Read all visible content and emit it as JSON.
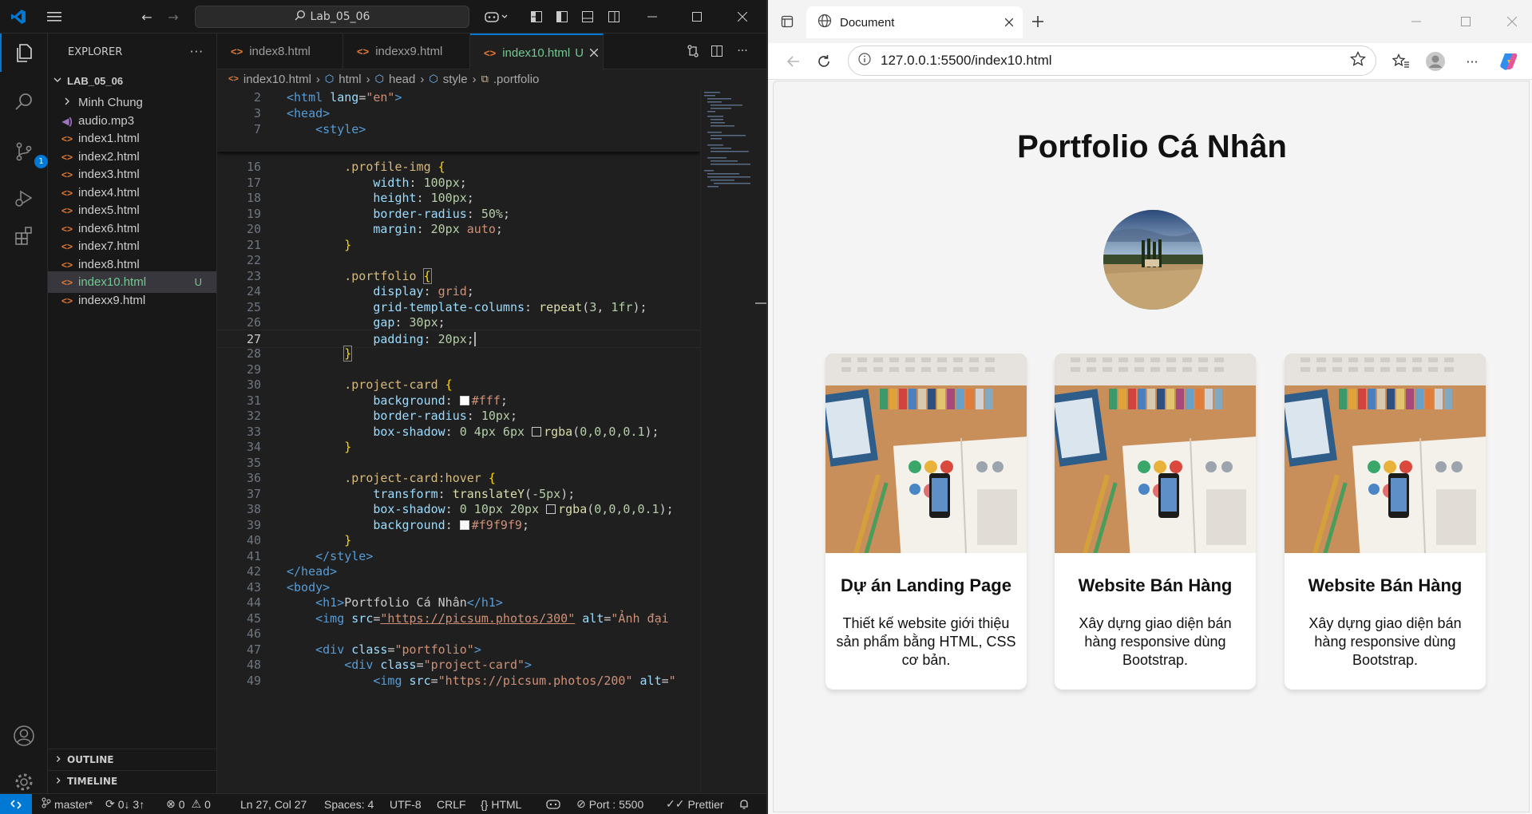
{
  "vscode": {
    "search_text": "Lab_05_06",
    "explorer_title": "EXPLORER",
    "project_name": "LAB_05_06",
    "files": [
      {
        "name": "Minh Chung",
        "type": "folder",
        "status": ""
      },
      {
        "name": "audio.mp3",
        "type": "audio",
        "status": ""
      },
      {
        "name": "index1.html",
        "type": "html",
        "status": ""
      },
      {
        "name": "index2.html",
        "type": "html",
        "status": ""
      },
      {
        "name": "index3.html",
        "type": "html",
        "status": ""
      },
      {
        "name": "index4.html",
        "type": "html",
        "status": ""
      },
      {
        "name": "index5.html",
        "type": "html",
        "status": ""
      },
      {
        "name": "index6.html",
        "type": "html",
        "status": ""
      },
      {
        "name": "index7.html",
        "type": "html",
        "status": ""
      },
      {
        "name": "index8.html",
        "type": "html",
        "status": ""
      },
      {
        "name": "index10.html",
        "type": "html",
        "status": "U"
      },
      {
        "name": "indexx9.html",
        "type": "html",
        "status": ""
      }
    ],
    "outline_label": "OUTLINE",
    "timeline_label": "TIMELINE",
    "scm_badge": "1",
    "tabs": [
      {
        "label": "index8.html",
        "modified": ""
      },
      {
        "label": "indexx9.html",
        "modified": ""
      },
      {
        "label": "index10.html",
        "modified": "U"
      }
    ],
    "breadcrumbs": [
      "index10.html",
      "html",
      "head",
      "style",
      ".portfolio"
    ],
    "status": {
      "branch": "master*",
      "sync": "0↓ 3↑",
      "errors": "0",
      "warnings": "0",
      "position": "Ln 27, Col 27",
      "spaces": "Spaces: 4",
      "encoding": "UTF-8",
      "eol": "CRLF",
      "language": "HTML",
      "port": "Port : 5500",
      "prettier": "Prettier"
    }
  },
  "browser": {
    "tab_title": "Document",
    "url": "127.0.0.1:5500/index10.html",
    "page": {
      "title": "Portfolio Cá Nhân",
      "cards": [
        {
          "title": "Dự án Landing Page",
          "desc": "Thiết kế website giới thiệu sản phẩm bằng HTML, CSS cơ bản."
        },
        {
          "title": "Website Bán Hàng",
          "desc": "Xây dựng giao diện bán hàng responsive dùng Bootstrap."
        },
        {
          "title": "Website Bán Hàng",
          "desc": "Xây dựng giao diện bán hàng responsive dùng Bootstrap."
        }
      ]
    }
  },
  "colors": {
    "accent": "#0078d4",
    "untracked": "#73c991",
    "html_icon": "#e37933"
  }
}
